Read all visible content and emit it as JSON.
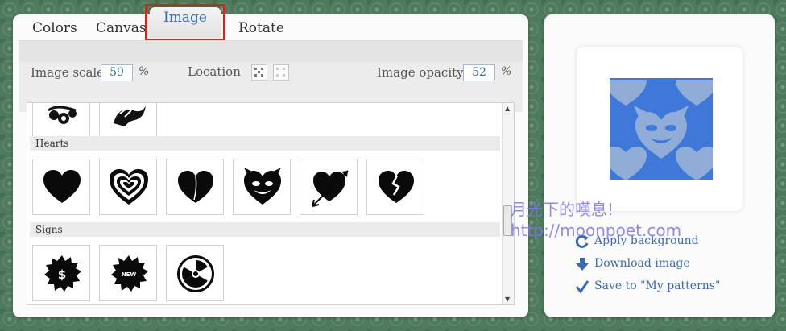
{
  "tabs": [
    {
      "label": "Colors"
    },
    {
      "label": "Canvas"
    },
    {
      "label": "Image"
    },
    {
      "label": "Rotate"
    }
  ],
  "settings": {
    "scale_label": "Image scale",
    "scale_value": "59",
    "scale_unit": "%",
    "location_label": "Location",
    "opacity_label": "Image opacity",
    "opacity_value": "52",
    "opacity_unit": "%"
  },
  "library": {
    "categories": [
      {
        "name": "Hearts",
        "items": [
          "heart",
          "heart-rings",
          "heart-glossy",
          "heart-devil",
          "heart-arrow",
          "heart-broken"
        ]
      },
      {
        "name": "Signs",
        "items": [
          "sign-dollar",
          "sign-new",
          "sign-radiation"
        ]
      }
    ],
    "new_badge_text": "NEW",
    "dollar_text": "$"
  },
  "actions": {
    "apply_label": "Apply background",
    "download_label": "Download image",
    "save_label": "Save to \"My patterns\""
  },
  "watermark": {
    "line1": "月光下的嘆息!",
    "line2": "http://moonpoet.com"
  },
  "colors": {
    "accent": "#3a6ab0",
    "preview_blue": "#3f78d8",
    "highlight_red": "#d92020"
  }
}
